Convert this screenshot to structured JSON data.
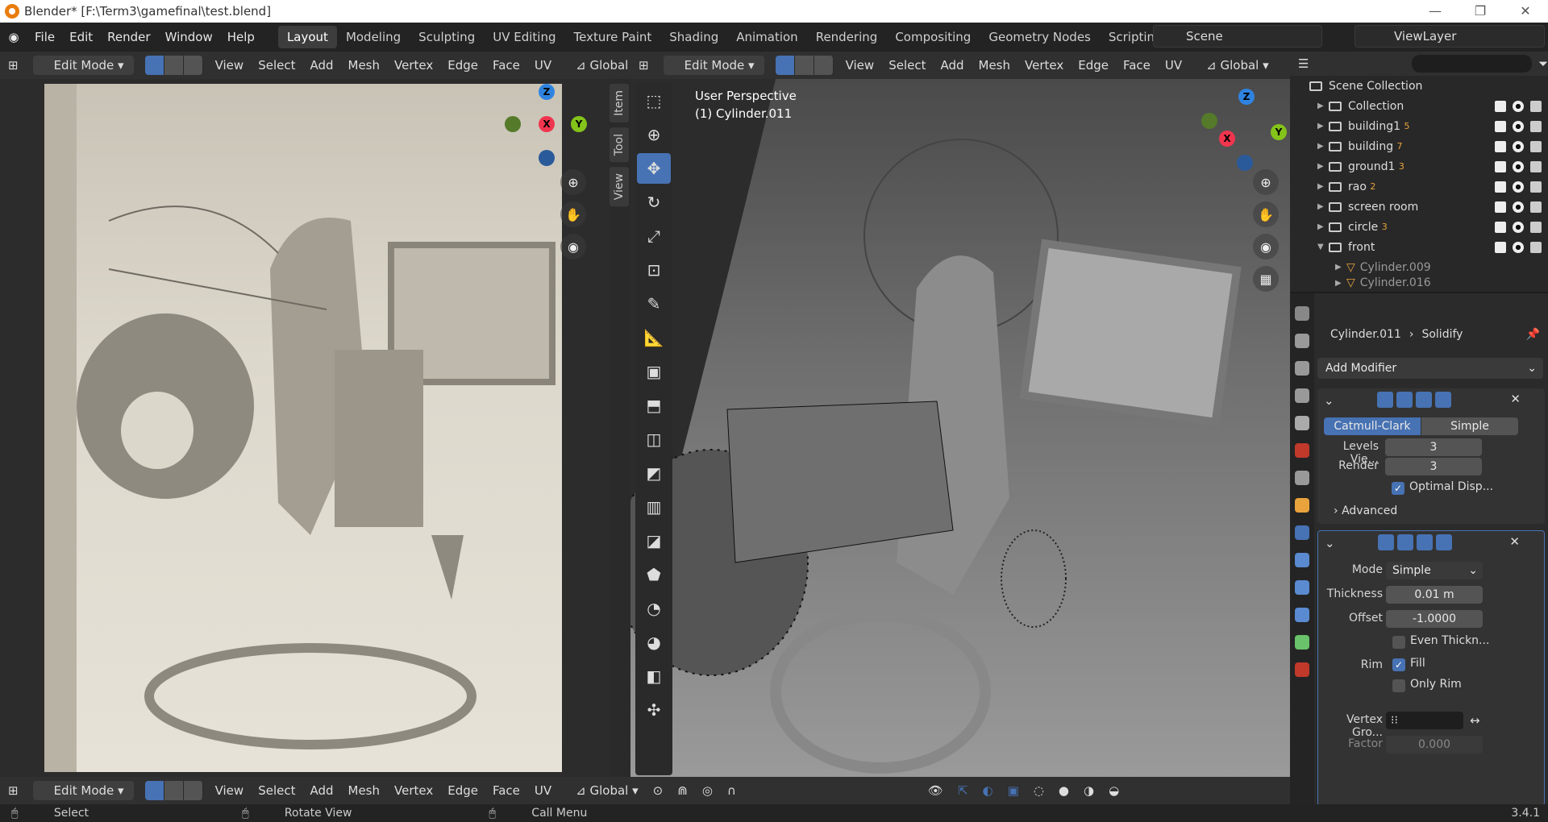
{
  "window": {
    "title": "Blender* [F:\\Term3\\gamefinal\\test.blend]",
    "min": "—",
    "max": "❐",
    "close": "✕"
  },
  "menu": [
    "File",
    "Edit",
    "Render",
    "Window",
    "Help"
  ],
  "workspaces": [
    "Layout",
    "Modeling",
    "Sculpting",
    "UV Editing",
    "Texture Paint",
    "Shading",
    "Animation",
    "Rendering",
    "Compositing",
    "Geometry Nodes",
    "Scripting",
    "+"
  ],
  "scene": "Scene",
  "view_layer": "ViewLayer",
  "left_header": {
    "mode": "Edit Mode",
    "items": [
      "View",
      "Select",
      "Add",
      "Mesh",
      "Vertex",
      "Edge",
      "Face",
      "UV"
    ],
    "orientation": "Global"
  },
  "right_header": {
    "mode": "Edit Mode",
    "items": [
      "View",
      "Select",
      "Add",
      "Mesh",
      "Vertex",
      "Edge",
      "Face",
      "UV"
    ],
    "orientation": "Global"
  },
  "bottom_header": {
    "mode": "Edit Mode",
    "items": [
      "View",
      "Select",
      "Add",
      "Mesh",
      "Vertex",
      "Edge",
      "Face",
      "UV"
    ],
    "orientation": "Global"
  },
  "side_tabs": [
    "Item",
    "Tool",
    "View"
  ],
  "viewport_label": {
    "line1": "User Perspective",
    "line2": "(1) Cylinder.011"
  },
  "gizmo": {
    "z": "Z",
    "x": "X",
    "y": "Y"
  },
  "outliner": {
    "root": "Scene Collection",
    "rows": [
      {
        "name": "Collection",
        "badge": ""
      },
      {
        "name": "building1",
        "badge": "5"
      },
      {
        "name": "building",
        "badge": "7"
      },
      {
        "name": "ground1",
        "badge": "3"
      },
      {
        "name": "rao",
        "badge": "2"
      },
      {
        "name": "screen room",
        "badge": ""
      },
      {
        "name": "circle",
        "badge": "3"
      },
      {
        "name": "front",
        "badge": ""
      },
      {
        "name": "Cylinder.009",
        "badge": ""
      },
      {
        "name": "Cylinder.016",
        "badge": ""
      }
    ]
  },
  "properties": {
    "breadcrumb_object": "Cylinder.011",
    "breadcrumb_modifier": "Solidify",
    "add_modifier": "Add Modifier",
    "subsurf": {
      "tab1": "Catmull-Clark",
      "tab2": "Simple",
      "levels_label": "Levels Vie...",
      "levels_value": "3",
      "render_label": "Render",
      "render_value": "3",
      "optimal": "Optimal Disp...",
      "advanced": "Advanced"
    },
    "solidify": {
      "mode_label": "Mode",
      "mode_value": "Simple",
      "thickness_label": "Thickness",
      "thickness_value": "0.01 m",
      "offset_label": "Offset",
      "offset_value": "-1.0000",
      "even": "Even Thickn...",
      "rim_label": "Rim",
      "fill": "Fill",
      "only_rim": "Only Rim",
      "vgroup_label": "Vertex Gro...",
      "factor_label": "Factor",
      "factor_value": "0.000"
    }
  },
  "statusbar": {
    "select": "Select",
    "rotate": "Rotate View",
    "call": "Call Menu",
    "version": "3.4.1"
  },
  "colors": {
    "accent": "#4772b3",
    "x_axis": "#f0354e",
    "y_axis": "#84c31a",
    "z_axis": "#2f83e0"
  }
}
